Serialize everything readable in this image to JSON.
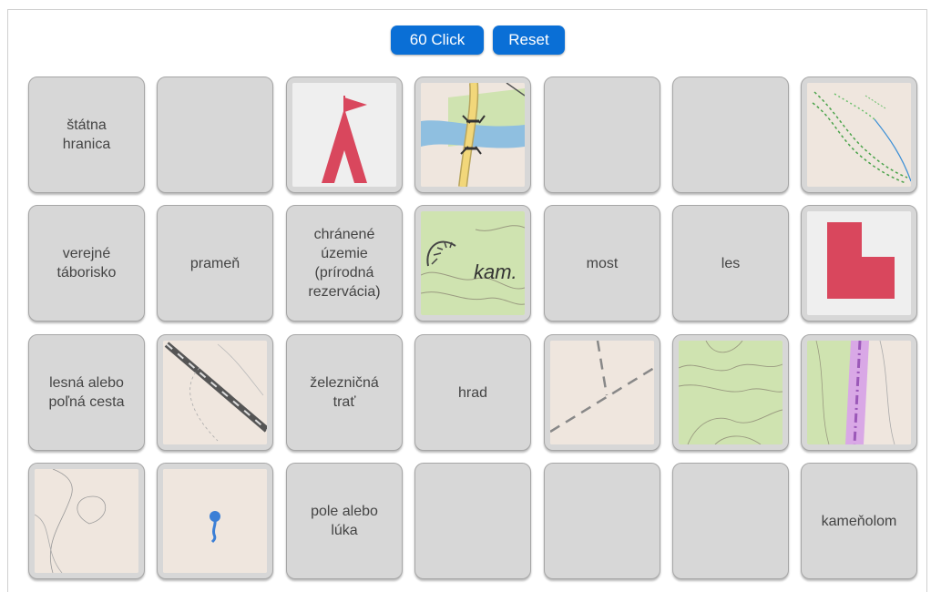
{
  "toolbar": {
    "clicks_label": "60 Click",
    "reset_label": "Reset"
  },
  "rows": [
    [
      {
        "type": "text",
        "text": "štátna\nhranica"
      },
      {
        "type": "blank"
      },
      {
        "type": "image",
        "icon": "red-flag-tent-icon"
      },
      {
        "type": "image",
        "icon": "map-bridge-icon"
      },
      {
        "type": "blank"
      },
      {
        "type": "blank"
      },
      {
        "type": "image",
        "icon": "map-hedge-path-icon"
      }
    ],
    [
      {
        "type": "text",
        "text": "verejné\ntáborisko"
      },
      {
        "type": "text",
        "text": "prameň"
      },
      {
        "type": "text",
        "text": "chránené\núzemie\n(prírodná\nrezervácia)"
      },
      {
        "type": "image",
        "icon": "map-quarry-icon",
        "caption": "kam."
      },
      {
        "type": "text",
        "text": "most"
      },
      {
        "type": "text",
        "text": "les"
      },
      {
        "type": "image",
        "icon": "red-l-shape-icon"
      }
    ],
    [
      {
        "type": "text",
        "text": "lesná alebo\npoľná cesta"
      },
      {
        "type": "image",
        "icon": "map-railway-icon"
      },
      {
        "type": "text",
        "text": "železničná\ntrať"
      },
      {
        "type": "text",
        "text": "hrad"
      },
      {
        "type": "image",
        "icon": "map-dashed-border-icon"
      },
      {
        "type": "image",
        "icon": "map-forest-icon"
      },
      {
        "type": "image",
        "icon": "map-protected-area-icon"
      }
    ],
    [
      {
        "type": "image",
        "icon": "map-meadow-icon"
      },
      {
        "type": "image",
        "icon": "map-spring-icon"
      },
      {
        "type": "text",
        "text": "pole alebo\nlúka"
      },
      {
        "type": "blank"
      },
      {
        "type": "blank"
      },
      {
        "type": "blank"
      },
      {
        "type": "text",
        "text": "kameňolom"
      }
    ]
  ],
  "colors": {
    "button": "#0a6fd6",
    "card": "#d7d7d7",
    "map_bg": "#f0e8e1",
    "symbol_red": "#d9475d"
  }
}
